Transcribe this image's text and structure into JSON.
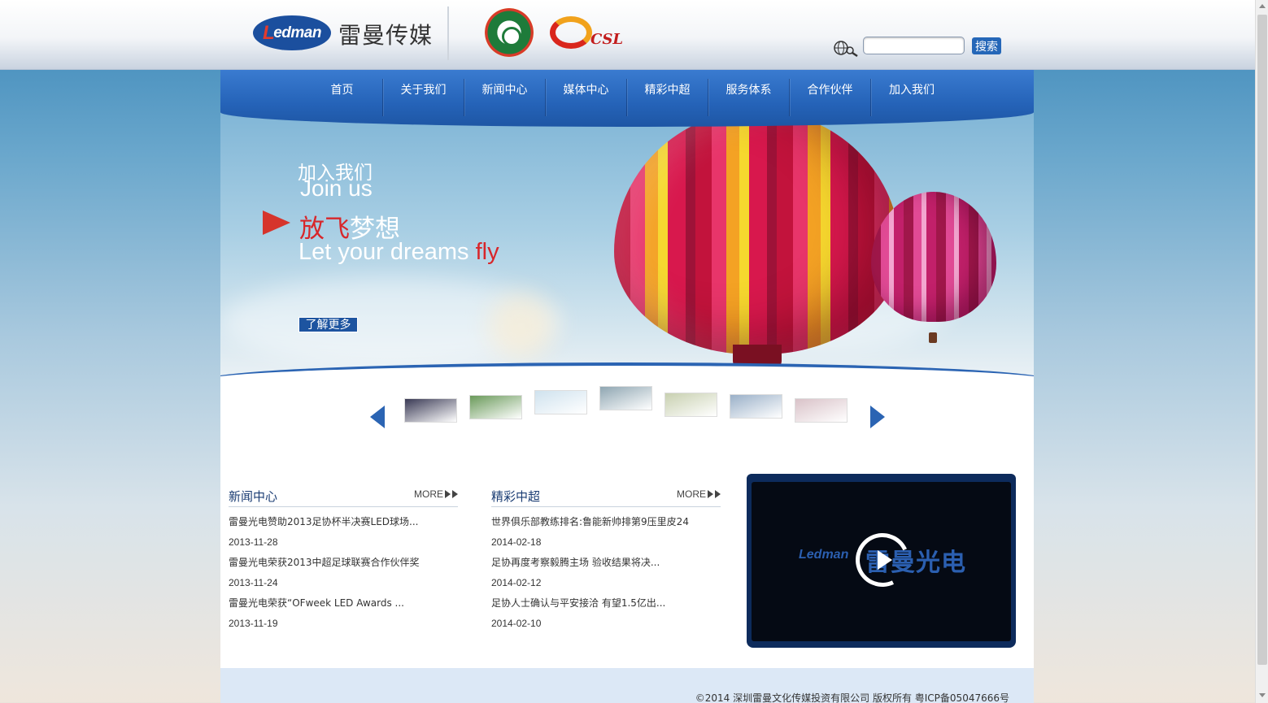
{
  "header": {
    "logo_text": "edman",
    "logo_letter": "L",
    "brand_name": "雷曼传媒",
    "partner_emblems": [
      "cfa-emblem",
      "csl-logo"
    ],
    "csl_text": "CSL",
    "search": {
      "placeholder": "",
      "value": "",
      "button_label": "搜索"
    }
  },
  "nav": {
    "items": [
      "首页",
      "关于我们",
      "新闻中心",
      "媒体中心",
      "精彩中超",
      "服务体系",
      "合作伙伴",
      "加入我们"
    ]
  },
  "banner": {
    "title_cn": "加入我们",
    "title_en": "Join us",
    "slogan_cn_red": "放飞",
    "slogan_cn_white": "梦想",
    "slogan_en_white": "Let your dreams ",
    "slogan_en_red": "fly",
    "more_button": "了解更多"
  },
  "thumbnails": {
    "count": 7,
    "colors": [
      "#3a3a55",
      "#6a9a5a",
      "#cfe2ee",
      "#8fa6b2",
      "#c8d0b0",
      "#9ab0c8",
      "#d9c2c8"
    ]
  },
  "news": {
    "title": "新闻中心",
    "more": "MORE",
    "items": [
      {
        "title": "雷曼光电赞助2013足协杯半决赛LED球场...",
        "date": "2013-11-28"
      },
      {
        "title": "雷曼光电荣获2013中超足球联赛合作伙伴奖",
        "date": "2013-11-24"
      },
      {
        "title": "雷曼光电荣获“OFweek LED Awards ...",
        "date": "2013-11-19"
      }
    ]
  },
  "csl": {
    "title": "精彩中超",
    "more": "MORE",
    "items": [
      {
        "title": "世界俱乐部教练排名:鲁能新帅排第9压里皮24",
        "date": "2014-02-18"
      },
      {
        "title": "足协再度考察毅腾主场 验收结果将决...",
        "date": "2014-02-12"
      },
      {
        "title": "足协人士确认与平安接洽 有望1.5亿出...",
        "date": "2014-02-10"
      }
    ]
  },
  "video": {
    "logo_text": "Ledman",
    "logo_cn": "雷曼光电"
  },
  "footer": {
    "copyright": "©2014 深圳雷曼文化传媒投资有限公司 版权所有 粤ICP备05047666号"
  }
}
